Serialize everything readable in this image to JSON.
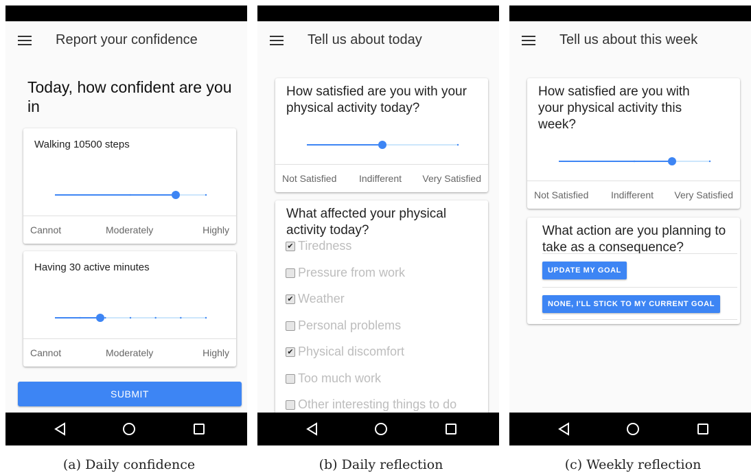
{
  "screens": [
    {
      "title": "Report your confidence",
      "question": "Today, how confident are you in",
      "cards": [
        {
          "label": "Walking 10500 steps",
          "slider_value": 0.8,
          "steps": 3,
          "scale": [
            "Cannot",
            "Moderately",
            "Highly"
          ]
        },
        {
          "label": "Having 30 active minutes",
          "slider_value": 0.3,
          "steps": 7,
          "scale": [
            "Cannot",
            "Moderately",
            "Highly"
          ]
        }
      ],
      "submit_label": "SUBMIT",
      "caption": "(a) Daily confidence"
    },
    {
      "title": "Tell us about today",
      "satisfaction": {
        "question": "How satisfied are you with your physical activity today?",
        "slider_value": 0.5,
        "steps": 3,
        "scale": [
          "Not Satisfied",
          "Indifferent",
          "Very Satisfied"
        ]
      },
      "factors": {
        "question": "What affected your physical activity today?",
        "options": [
          {
            "label": "Tiredness",
            "checked": true
          },
          {
            "label": "Pressure from work",
            "checked": false
          },
          {
            "label": "Weather",
            "checked": true
          },
          {
            "label": "Personal problems",
            "checked": false
          },
          {
            "label": "Physical discomfort",
            "checked": true
          },
          {
            "label": "Too much work",
            "checked": false
          },
          {
            "label": "Other interesting things to do",
            "checked": false
          }
        ]
      },
      "caption": "(b) Daily reflection"
    },
    {
      "title": "Tell us about this week",
      "satisfaction": {
        "question": "How satisfied are you with your physical activity this week?",
        "slider_value": 0.75,
        "steps": 3,
        "scale": [
          "Not Satisfied",
          "Indifferent",
          "Very Satisfied"
        ]
      },
      "action": {
        "question": "What action are you planning to take as a consequence?",
        "buttons": [
          "UPDATE MY GOAL",
          "NONE, I'LL STICK TO MY CURRENT GOAL"
        ]
      },
      "caption": "(c) Weekly reflection"
    }
  ],
  "colors": {
    "accent": "#3d85f4",
    "track": "#bbdefb",
    "bars": "#000000"
  },
  "icons": [
    "menu-icon",
    "back-icon",
    "home-icon",
    "recent-apps-icon"
  ]
}
